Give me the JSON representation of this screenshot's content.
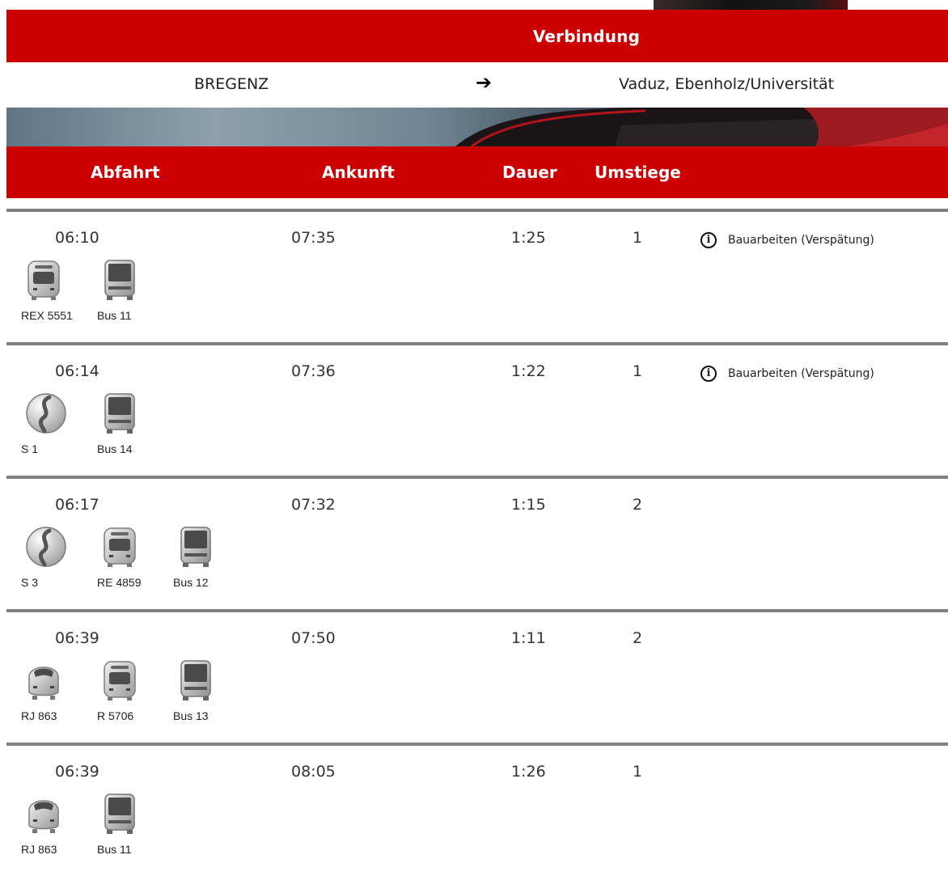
{
  "app": {
    "title": "Verbindung"
  },
  "route": {
    "from": "BREGENZ",
    "arrow": "➔",
    "to": "Vaduz, Ebenholz/Universität"
  },
  "columns": {
    "departure": "Abfahrt",
    "arrival": "Ankunft",
    "duration": "Dauer",
    "changes": "Umstiege"
  },
  "colors": {
    "brand_red": "#cc0000",
    "divider": "#808080"
  },
  "connections": [
    {
      "departure": "06:10",
      "arrival": "07:35",
      "duration": "1:25",
      "changes": "1",
      "note": "Bauarbeiten (Verspätung)",
      "vehicles": [
        {
          "type": "train-icon",
          "label": "REX 5551"
        },
        {
          "type": "bus-icon",
          "label": "Bus 11"
        }
      ]
    },
    {
      "departure": "06:14",
      "arrival": "07:36",
      "duration": "1:22",
      "changes": "1",
      "note": "Bauarbeiten (Verspätung)",
      "vehicles": [
        {
          "type": "sbahn-icon",
          "label": "S 1"
        },
        {
          "type": "bus-icon",
          "label": "Bus 14"
        }
      ]
    },
    {
      "departure": "06:17",
      "arrival": "07:32",
      "duration": "1:15",
      "changes": "2",
      "note": "",
      "vehicles": [
        {
          "type": "sbahn-icon",
          "label": "S 3"
        },
        {
          "type": "train-icon",
          "label": "RE 4859"
        },
        {
          "type": "bus-icon",
          "label": "Bus 12"
        }
      ]
    },
    {
      "departure": "06:39",
      "arrival": "07:50",
      "duration": "1:11",
      "changes": "2",
      "note": "",
      "vehicles": [
        {
          "type": "railjet-icon",
          "label": "RJ 863"
        },
        {
          "type": "train-icon",
          "label": "R 5706"
        },
        {
          "type": "bus-icon",
          "label": "Bus 13"
        }
      ]
    },
    {
      "departure": "06:39",
      "arrival": "08:05",
      "duration": "1:26",
      "changes": "1",
      "note": "",
      "vehicles": [
        {
          "type": "railjet-icon",
          "label": "RJ 863"
        },
        {
          "type": "bus-icon",
          "label": "Bus 11"
        }
      ]
    }
  ]
}
